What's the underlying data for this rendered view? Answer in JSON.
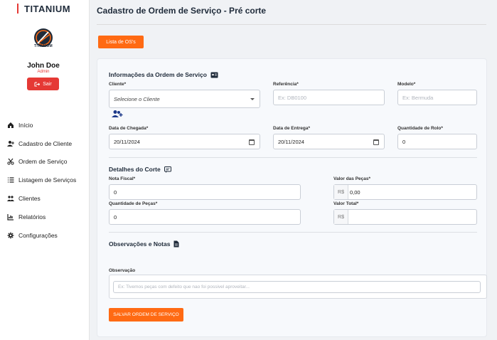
{
  "brand": "TITANIUM",
  "logo_text": "TITANIUM",
  "user": {
    "name": "John Doe",
    "role": "Admin",
    "logout_label": "Sair"
  },
  "nav": [
    {
      "label": "Início",
      "icon": "home-icon"
    },
    {
      "label": "Cadastro de Cliente",
      "icon": "user-plus-icon"
    },
    {
      "label": "Ordem de Serviço",
      "icon": "scissors-icon"
    },
    {
      "label": "Listagem de Serviços",
      "icon": "list-icon"
    },
    {
      "label": "Clientes",
      "icon": "users-icon"
    },
    {
      "label": "Relatórios",
      "icon": "chart-icon"
    },
    {
      "label": "Configurações",
      "icon": "gear-icon"
    }
  ],
  "page_title": "Cadastro de Ordem de Serviço - Pré corte",
  "list_button": "Lista de OS's",
  "sections": {
    "order_info": {
      "title": "Informações da Ordem de Serviço",
      "cliente_label": "Cliente*",
      "cliente_value": "Selecione o Cliente",
      "referencia_label": "Referência*",
      "referencia_placeholder": "Ex: DB0100",
      "modelo_label": "Modelo*",
      "modelo_placeholder": "Ex: Bermuda",
      "chegada_label": "Data de Chegada*",
      "chegada_value": "20/11/2024",
      "entrega_label": "Data de Entrega*",
      "entrega_value": "20/11/2024",
      "rolo_label": "Quantidade de Rolo*",
      "rolo_value": "0"
    },
    "cut_details": {
      "title": "Detalhes do Corte",
      "nota_label": "Nota Fiscal*",
      "nota_value": "0",
      "valor_pecas_label": "Valor das Peças*",
      "valor_pecas_prefix": "R$",
      "valor_pecas_value": "0,00",
      "qtd_pecas_label": "Quantidade de Peças*",
      "qtd_pecas_value": "0",
      "valor_total_label": "Valor Total*",
      "valor_total_prefix": "R$",
      "valor_total_value": ""
    },
    "notes": {
      "title": "Observações e Notas",
      "obs_label": "Observação",
      "obs_placeholder": "Ex: Tivemos peças com defeito que nao foi possivel aproveitar..."
    }
  },
  "save_button": "SALVAR ORDEM DE SERVIÇO",
  "colors": {
    "accent": "#ff6a13",
    "danger": "#e53935"
  }
}
